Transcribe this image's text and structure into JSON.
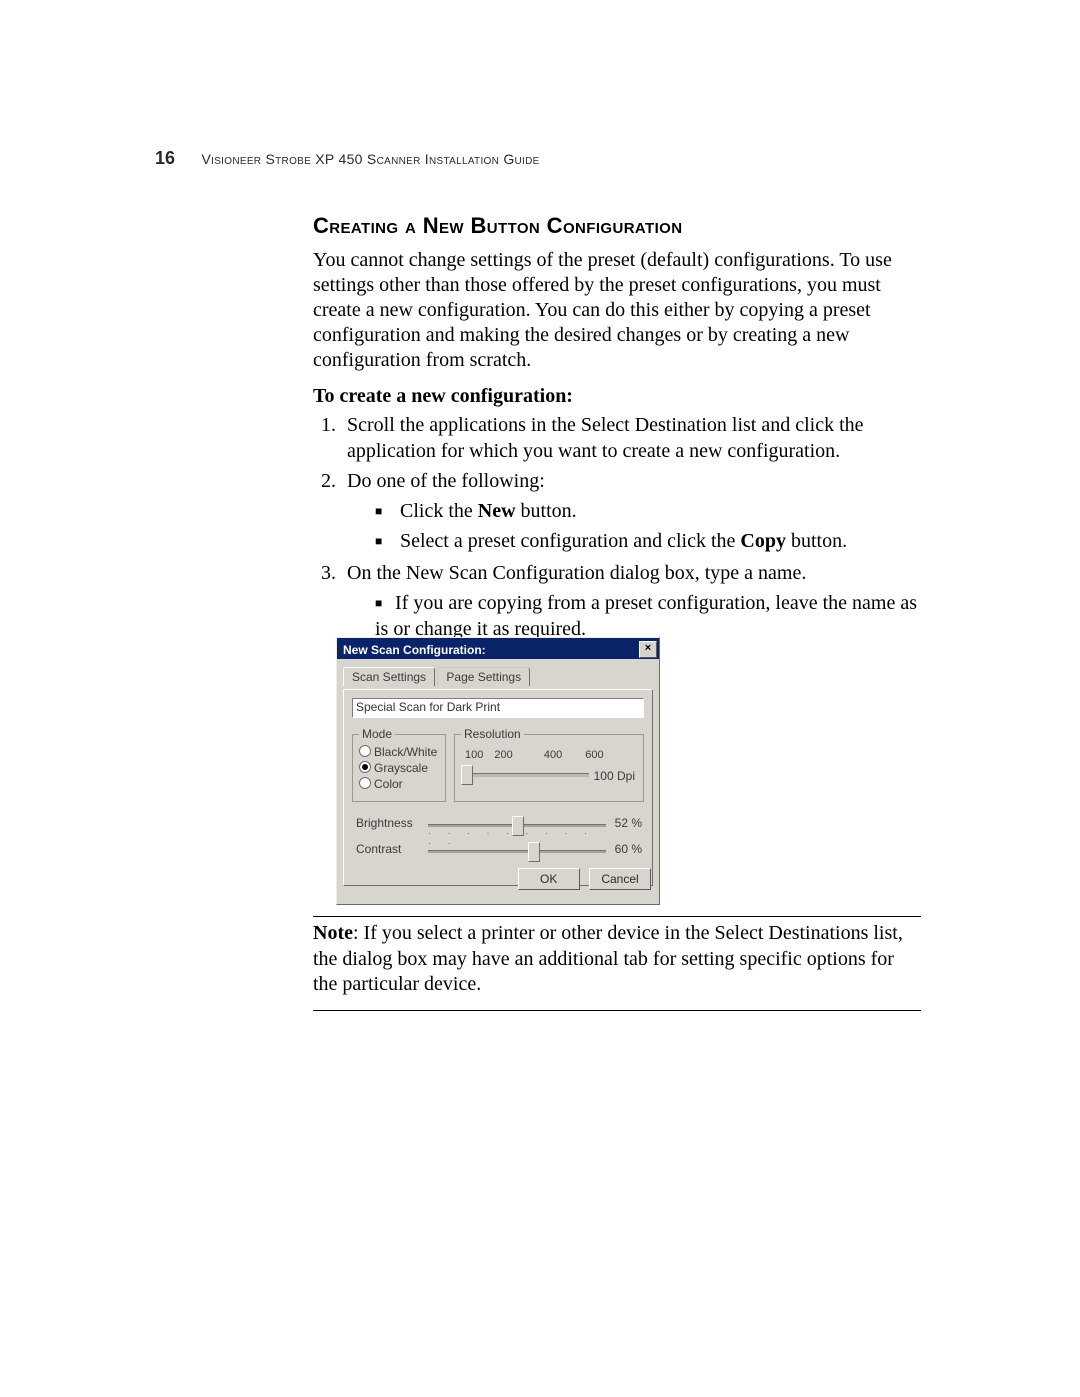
{
  "page": {
    "number": "16",
    "guide_title": "Visioneer Strobe XP 450 Scanner Installation Guide"
  },
  "section": {
    "heading": "Creating a New Button Configuration",
    "intro": "You cannot change settings of the preset (default) configurations. To use settings other than those offered by the preset configurations, you must create a new configuration. You can do this either by copying a preset configuration and making the desired changes or by creating a new configuration from scratch.",
    "procedure_title": "To create a new configuration:",
    "steps": {
      "s1": "Scroll the applications in the Select Destination list and click the application for which you want to create a new configuration.",
      "s2": "Do one of the following:",
      "s2a_pre": "Click the ",
      "s2a_bold": "New",
      "s2a_post": " button.",
      "s2b_pre": "Select a preset configuration and click the ",
      "s2b_bold": "Copy",
      "s2b_post": " button.",
      "s3": "On the New Scan Configuration dialog box, type a name.",
      "s3a": "If you are copying from a preset configuration, leave the name as is or change it as required."
    },
    "note_label": "Note",
    "note_body": ":  If you select a printer or other device in the Select Destinations list, the dialog box may have an additional tab for setting specific options for the particular device."
  },
  "dialog": {
    "title": "New Scan Configuration:",
    "close_glyph": "×",
    "tabs": {
      "scan": "Scan Settings",
      "page": "Page Settings"
    },
    "name_value": "Special Scan for Dark Print",
    "mode": {
      "legend": "Mode",
      "black_white": "Black/White",
      "grayscale": "Grayscale",
      "color": "Color",
      "selected": "grayscale"
    },
    "resolution": {
      "legend": "Resolution",
      "marks": {
        "m100": "100",
        "m200": "200",
        "m400": "400",
        "m600": "600"
      },
      "value_label": "100  Dpi"
    },
    "brightness": {
      "label": "Brightness",
      "value": "52 %"
    },
    "contrast": {
      "label": "Contrast",
      "value": "60 %"
    },
    "buttons": {
      "ok": "OK",
      "cancel": "Cancel"
    }
  }
}
